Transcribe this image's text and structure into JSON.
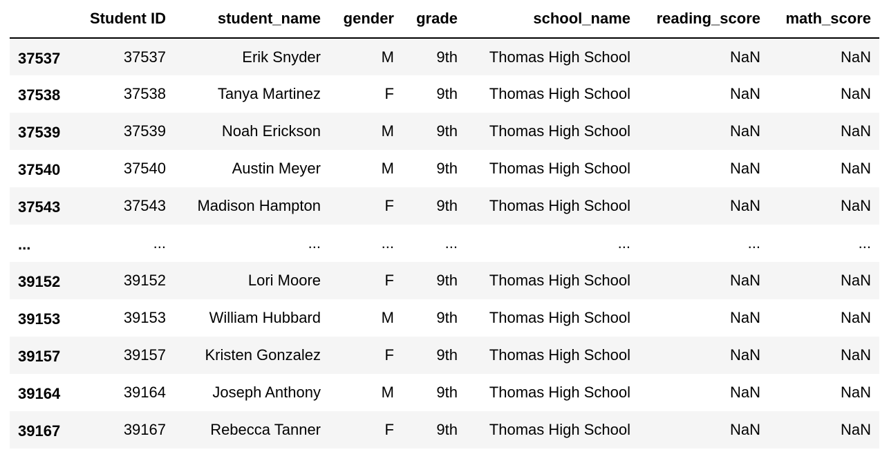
{
  "table": {
    "columns": [
      "",
      "Student ID",
      "student_name",
      "gender",
      "grade",
      "school_name",
      "reading_score",
      "math_score"
    ],
    "rows": [
      [
        "37537",
        "37537",
        "Erik Snyder",
        "M",
        "9th",
        "Thomas High School",
        "NaN",
        "NaN"
      ],
      [
        "37538",
        "37538",
        "Tanya Martinez",
        "F",
        "9th",
        "Thomas High School",
        "NaN",
        "NaN"
      ],
      [
        "37539",
        "37539",
        "Noah Erickson",
        "M",
        "9th",
        "Thomas High School",
        "NaN",
        "NaN"
      ],
      [
        "37540",
        "37540",
        "Austin Meyer",
        "M",
        "9th",
        "Thomas High School",
        "NaN",
        "NaN"
      ],
      [
        "37543",
        "37543",
        "Madison Hampton",
        "F",
        "9th",
        "Thomas High School",
        "NaN",
        "NaN"
      ],
      [
        "...",
        "...",
        "...",
        "...",
        "...",
        "...",
        "...",
        "..."
      ],
      [
        "39152",
        "39152",
        "Lori Moore",
        "F",
        "9th",
        "Thomas High School",
        "NaN",
        "NaN"
      ],
      [
        "39153",
        "39153",
        "William Hubbard",
        "M",
        "9th",
        "Thomas High School",
        "NaN",
        "NaN"
      ],
      [
        "39157",
        "39157",
        "Kristen Gonzalez",
        "F",
        "9th",
        "Thomas High School",
        "NaN",
        "NaN"
      ],
      [
        "39164",
        "39164",
        "Joseph Anthony",
        "M",
        "9th",
        "Thomas High School",
        "NaN",
        "NaN"
      ],
      [
        "39167",
        "39167",
        "Rebecca Tanner",
        "F",
        "9th",
        "Thomas High School",
        "NaN",
        "NaN"
      ]
    ]
  },
  "colors": {
    "stripe": "#f5f5f5",
    "header_rule": "#000000"
  }
}
